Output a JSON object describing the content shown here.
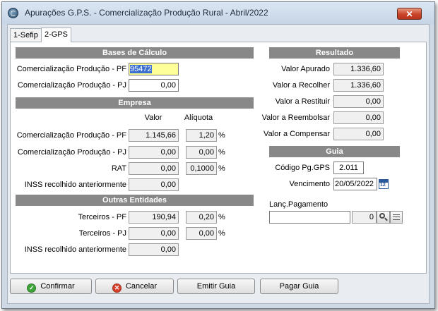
{
  "window": {
    "title": "Apurações G.P.S. - Comercialização Produção Rural - Abril/2022",
    "close_glyph": "✕"
  },
  "tabs": [
    {
      "label": "1-Sefip"
    },
    {
      "label": "2-GPS"
    }
  ],
  "bases": {
    "header": "Bases de Cálculo",
    "pf_label": "Comercialização Produção - PF",
    "pf_value": "95472",
    "pj_label": "Comercialização Produção - PJ",
    "pj_value": "0,00"
  },
  "empresa": {
    "header": "Empresa",
    "col_valor": "Valor",
    "col_aliquota": "Alíquota",
    "rows": [
      {
        "label": "Comercialização Produção - PF",
        "valor": "1.145,66",
        "aliquota": "1,20",
        "pct": "%"
      },
      {
        "label": "Comercialização Produção - PJ",
        "valor": "0,00",
        "aliquota": "0,00",
        "pct": "%"
      },
      {
        "label": "RAT",
        "valor": "0,00",
        "aliquota": "0,1000",
        "pct": "%"
      }
    ],
    "inss_label": "INSS recolhido anteriormente",
    "inss_value": "0,00"
  },
  "outras": {
    "header": "Outras Entidades",
    "rows": [
      {
        "label": "Terceiros - PF",
        "valor": "190,94",
        "aliquota": "0,20",
        "pct": "%"
      },
      {
        "label": "Terceiros - PJ",
        "valor": "0,00",
        "aliquota": "0,00",
        "pct": "%"
      }
    ],
    "inss_label": "INSS recolhido anteriormente",
    "inss_value": "0,00"
  },
  "resultado": {
    "header": "Resultado",
    "rows": [
      {
        "label": "Valor Apurado",
        "value": "1.336,60"
      },
      {
        "label": "Valor a Recolher",
        "value": "1.336,60"
      },
      {
        "label": "Valor a Restituir",
        "value": "0,00"
      },
      {
        "label": "Valor a Reembolsar",
        "value": "0,00"
      },
      {
        "label": "Valor a Compensar",
        "value": "0,00"
      }
    ]
  },
  "guia": {
    "header": "Guia",
    "codigo_label": "Código Pg.GPS",
    "codigo_value": "2.011",
    "vencimento_label": "Vencimento",
    "vencimento_value": "20/05/2022"
  },
  "lanc": {
    "label": "Lanç.Pagamento",
    "text_value": "",
    "num_value": "0"
  },
  "buttons": {
    "confirmar": "Confirmar",
    "cancelar": "Cancelar",
    "emitir": "Emitir Guia",
    "pagar": "Pagar Guia"
  },
  "colors": {
    "section_header": "#888888",
    "focus_bg": "#ffff99",
    "selection": "#3b6fd0",
    "close": "#c9442a"
  }
}
